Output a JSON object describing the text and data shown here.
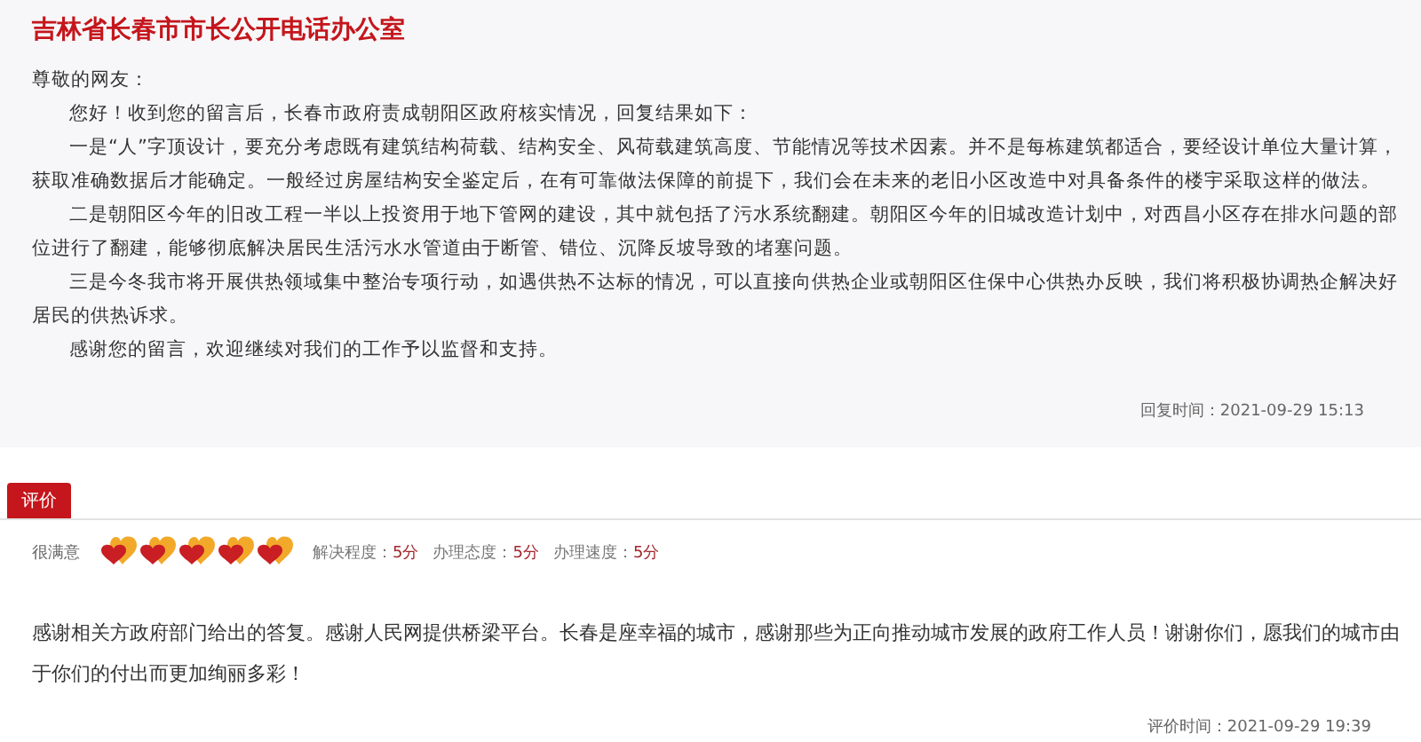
{
  "reply": {
    "title": "吉林省长春市市长公开电话办公室",
    "greeting": "尊敬的网友：",
    "paragraphs": [
      "您好！收到您的留言后，长春市政府责成朝阳区政府核实情况，回复结果如下：",
      "一是“人”字顶设计，要充分考虑既有建筑结构荷载、结构安全、风荷载建筑高度、节能情况等技术因素。并不是每栋建筑都适合，要经设计单位大量计算，获取准确数据后才能确定。一般经过房屋结构安全鉴定后，在有可靠做法保障的前提下，我们会在未来的老旧小区改造中对具备条件的楼宇采取这样的做法。",
      "二是朝阳区今年的旧改工程一半以上投资用于地下管网的建设，其中就包括了污水系统翻建。朝阳区今年的旧城改造计划中，对西昌小区存在排水问题的部位进行了翻建，能够彻底解决居民生活污水水管道由于断管、错位、沉降反坡导致的堵塞问题。",
      "三是今冬我市将开展供热领域集中整治专项行动，如遇供热不达标的情况，可以直接向供热企业或朝阳区住保中心供热办反映，我们将积极协调热企解决好居民的供热诉求。",
      "感谢您的留言，欢迎继续对我们的工作予以监督和支持。"
    ],
    "time": "回复时间：2021-09-29 15:13"
  },
  "evaluation": {
    "tab": "评价",
    "satisfaction": "很满意",
    "stars": 5,
    "scores": [
      {
        "label": "解决程度：",
        "value": "5分"
      },
      {
        "label": "办理态度：",
        "value": "5分"
      },
      {
        "label": "办理速度：",
        "value": "5分"
      }
    ],
    "comment": "感谢相关方政府部门给出的答复。感谢人民网提供桥梁平台。长春是座幸福的城市，感谢那些为正向推动城市发展的政府工作人员！谢谢你们，愿我们的城市由于你们的付出而更加绚丽多彩！",
    "time": "评价时间：2021-09-29 19:39"
  }
}
